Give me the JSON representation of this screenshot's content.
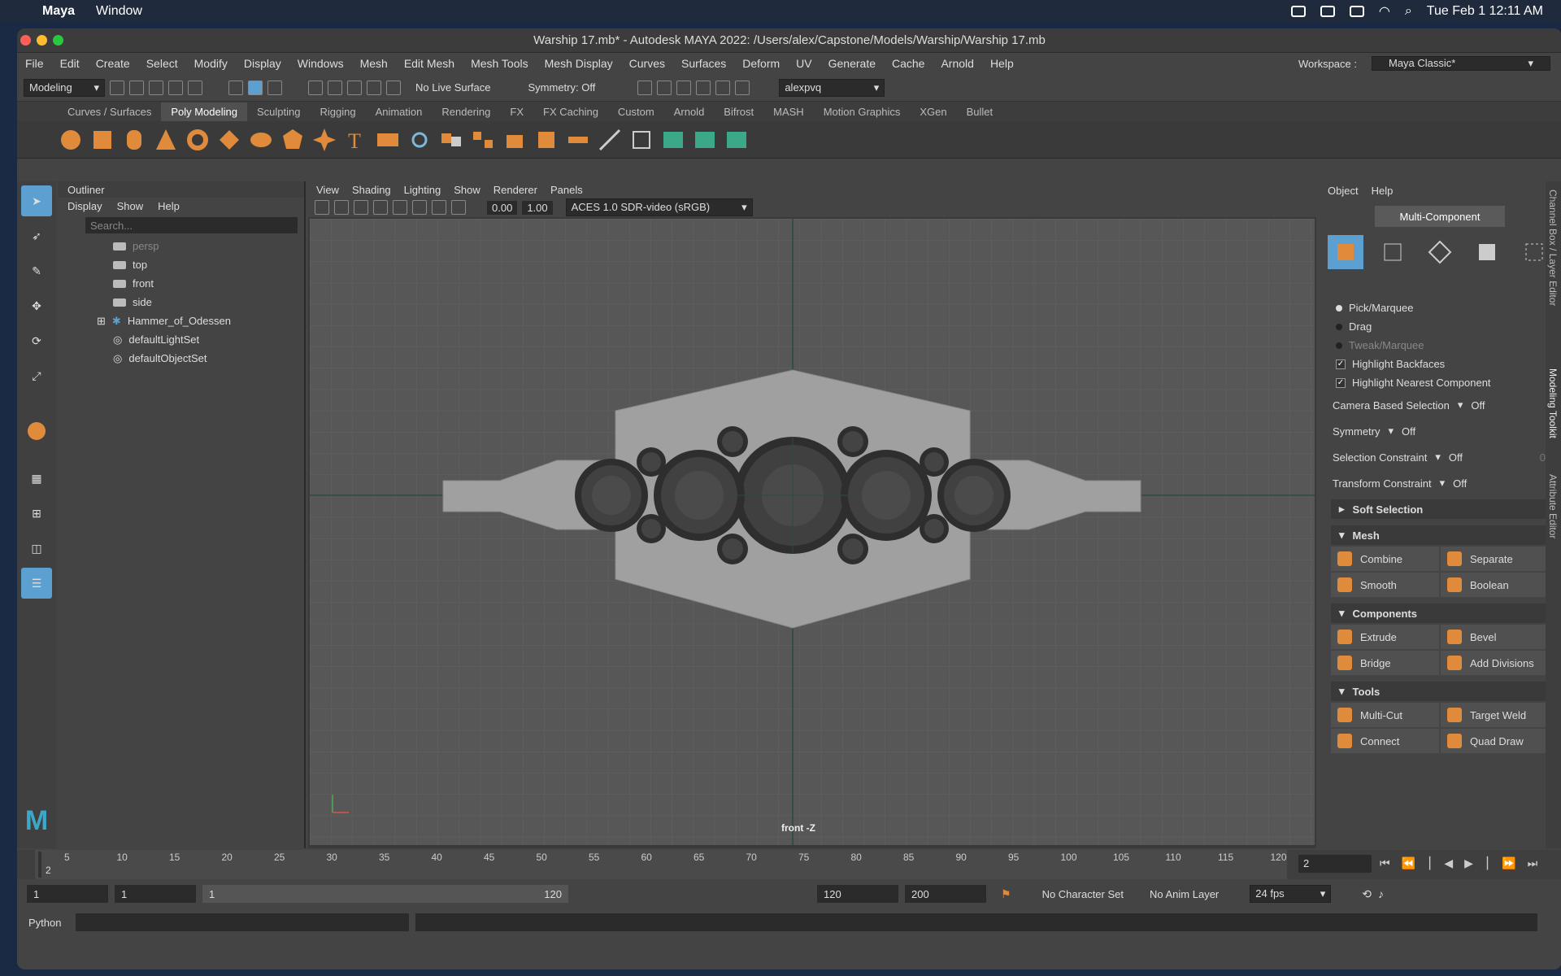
{
  "macbar": {
    "app": "Maya",
    "window": "Window",
    "datetime": "Tue Feb 1  12:11 AM"
  },
  "window": {
    "title": "Warship 17.mb* - Autodesk MAYA 2022: /Users/alex/Capstone/Models/Warship/Warship 17.mb"
  },
  "menu": [
    "File",
    "Edit",
    "Create",
    "Select",
    "Modify",
    "Display",
    "Windows",
    "Mesh",
    "Edit Mesh",
    "Mesh Tools",
    "Mesh Display",
    "Curves",
    "Surfaces",
    "Deform",
    "UV",
    "Generate",
    "Cache",
    "Arnold",
    "Help"
  ],
  "workspace": {
    "label": "Workspace :",
    "value": "Maya Classic*"
  },
  "status": {
    "mode": "Modeling",
    "live": "No Live Surface",
    "symmetry": "Symmetry: Off",
    "user": "alexpvq"
  },
  "shelf_tabs": [
    "Curves / Surfaces",
    "Poly Modeling",
    "Sculpting",
    "Rigging",
    "Animation",
    "Rendering",
    "FX",
    "FX Caching",
    "Custom",
    "Arnold",
    "Bifrost",
    "MASH",
    "Motion Graphics",
    "XGen",
    "Bullet"
  ],
  "outliner": {
    "title": "Outliner",
    "menu": [
      "Display",
      "Show",
      "Help"
    ],
    "search": "Search...",
    "items": [
      "persp",
      "top",
      "front",
      "side",
      "Hammer_of_Odessen",
      "defaultLightSet",
      "defaultObjectSet"
    ]
  },
  "viewport": {
    "menu": [
      "View",
      "Shading",
      "Lighting",
      "Show",
      "Renderer",
      "Panels"
    ],
    "exposure": "0.00",
    "gamma": "1.00",
    "colorspace": "ACES 1.0 SDR-video (sRGB)",
    "camera_label": "front -Z"
  },
  "modeling": {
    "menu": [
      "Object",
      "Help"
    ],
    "mode": "Multi-Component",
    "pick": [
      "Pick/Marquee",
      "Drag",
      "Tweak/Marquee"
    ],
    "checks": [
      "Highlight Backfaces",
      "Highlight Nearest Component"
    ],
    "drops": [
      {
        "label": "Camera Based Selection",
        "value": "Off"
      },
      {
        "label": "Symmetry",
        "value": "Off"
      },
      {
        "label": "Selection Constraint",
        "value": "Off",
        "extra": "0"
      },
      {
        "label": "Transform Constraint",
        "value": "Off"
      }
    ],
    "soft": "Soft Selection",
    "mesh": "Mesh",
    "mesh_btns": [
      "Combine",
      "Separate",
      "Smooth",
      "Boolean"
    ],
    "components": "Components",
    "comp_btns": [
      "Extrude",
      "Bevel",
      "Bridge",
      "Add Divisions"
    ],
    "tools": "Tools",
    "tool_btns": [
      "Multi-Cut",
      "Target Weld",
      "Connect",
      "Quad Draw"
    ]
  },
  "side_tabs": [
    "Channel Box / Layer Editor",
    "Modeling Toolkit",
    "Attribute Editor"
  ],
  "timeline": {
    "ticks": [
      "5",
      "10",
      "15",
      "20",
      "25",
      "30",
      "35",
      "40",
      "45",
      "50",
      "55",
      "60",
      "65",
      "70",
      "75",
      "80",
      "85",
      "90",
      "95",
      "100",
      "105",
      "110",
      "115",
      "120"
    ],
    "start_marker": "2",
    "current": "2"
  },
  "range": {
    "start": "1",
    "start2": "1",
    "slider_start": "1",
    "slider_end": "120",
    "end": "120",
    "end2": "200",
    "charset": "No Character Set",
    "anim": "No Anim Layer",
    "fps": "24 fps"
  },
  "python": {
    "label": "Python"
  },
  "colors": {
    "accent": "#5ba0d0",
    "orange": "#e08a3c"
  }
}
